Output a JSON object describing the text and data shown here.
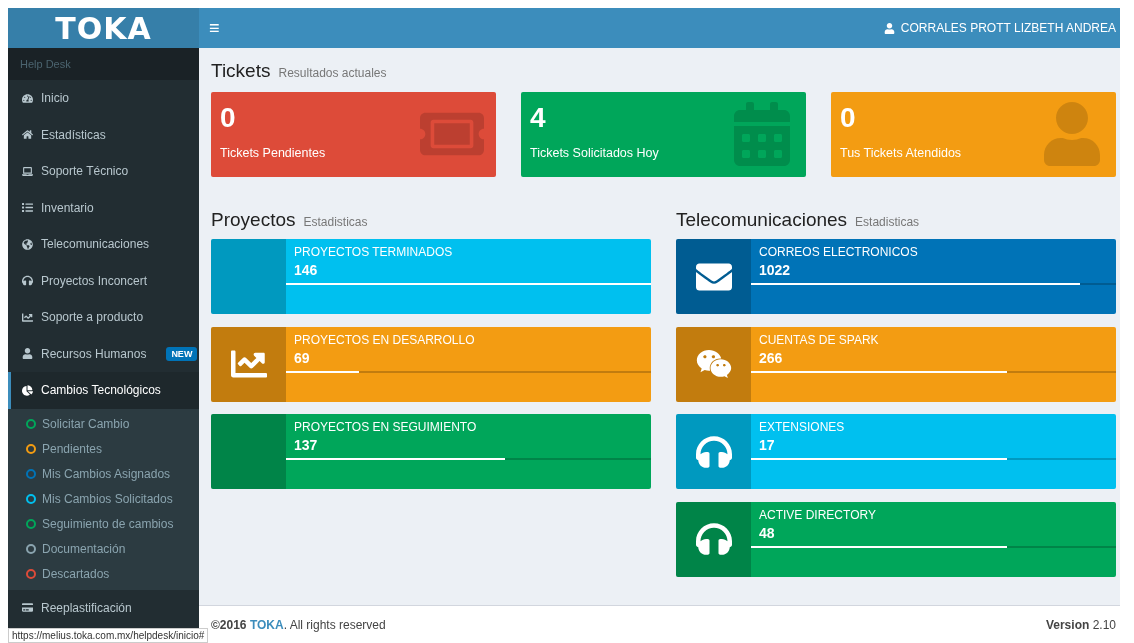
{
  "sidebar": {
    "logo": "TOKA",
    "section": "Help Desk",
    "items": [
      {
        "label": "Inicio",
        "selected": false
      },
      {
        "label": "Estadísticas",
        "selected": false
      },
      {
        "label": "Soporte Técnico",
        "selected": false
      },
      {
        "label": "Inventario",
        "selected": false
      },
      {
        "label": "Telecomunicaciones",
        "selected": false
      },
      {
        "label": "Proyectos Inconcert",
        "selected": false
      },
      {
        "label": "Soporte a producto",
        "selected": false
      },
      {
        "label": "Recursos Humanos",
        "selected": false,
        "badge": "NEW"
      },
      {
        "label": "Cambios Tecnológicos",
        "selected": true,
        "expanded": true,
        "children": [
          {
            "label": "Solicitar Cambio",
            "color": "#00a65a"
          },
          {
            "label": "Pendientes",
            "color": "#f39c12"
          },
          {
            "label": "Mis Cambios Asignados",
            "color": "#0073b7"
          },
          {
            "label": "Mis Cambios Solicitados",
            "color": "#00c0ef"
          },
          {
            "label": "Seguimiento de cambios",
            "color": "#00a65a"
          },
          {
            "label": "Documentación",
            "color": "#8aa4af"
          },
          {
            "label": "Descartados",
            "color": "#dd4b39"
          }
        ]
      },
      {
        "label": "Reeplastificación",
        "selected": false
      }
    ]
  },
  "topbar": {
    "menu_icon": "≡",
    "user": "CORRALES PROTT LIZBETH ANDREA"
  },
  "tickets": {
    "title": "Tickets",
    "subtitle": "Resultados actuales",
    "boxes": [
      {
        "value": "0",
        "label": "Tickets Pendientes",
        "color": "#dd4b39"
      },
      {
        "value": "4",
        "label": "Tickets Solicitados Hoy",
        "color": "#00a65a"
      },
      {
        "value": "0",
        "label": "Tus Tickets Atendidos",
        "color": "#f39c12"
      }
    ]
  },
  "proyectos": {
    "title": "Proyectos",
    "subtitle": "Estadisticas",
    "boxes": [
      {
        "label": "PROYECTOS TERMINADOS",
        "value": "146",
        "level": 1.0,
        "color": "#00c0ef"
      },
      {
        "label": "PROYECTOS EN DESARROLLO",
        "value": "69",
        "level": 0.2,
        "color": "#f39c12"
      },
      {
        "label": "PROYECTOS EN SEGUIMIENTO",
        "value": "137",
        "level": 0.6,
        "color": "#00a65a"
      }
    ]
  },
  "telecomunicaciones": {
    "title": "Telecomunicaciones",
    "subtitle": "Estadisticas",
    "boxes": [
      {
        "label": "CORREOS ELECTRONICOS",
        "value": "1022",
        "level": 0.9,
        "color": "#0073b7"
      },
      {
        "label": "CUENTAS DE SPARK",
        "value": "266",
        "level": 0.7,
        "color": "#f39c12"
      },
      {
        "label": "EXTENSIONES",
        "value": "17",
        "level": 0.7,
        "color": "#00c0ef"
      },
      {
        "label": "ACTIVE DIRECTORY",
        "value": "48",
        "level": 0.7,
        "color": "#00a65a"
      }
    ]
  },
  "footer": {
    "copyright": "©2016",
    "company": "TOKA",
    "rights": ". All rights reserved",
    "version_label": "Version",
    "version": "2.10"
  },
  "status_url": "https://melius.toka.com.mx/helpdesk/inicio#"
}
